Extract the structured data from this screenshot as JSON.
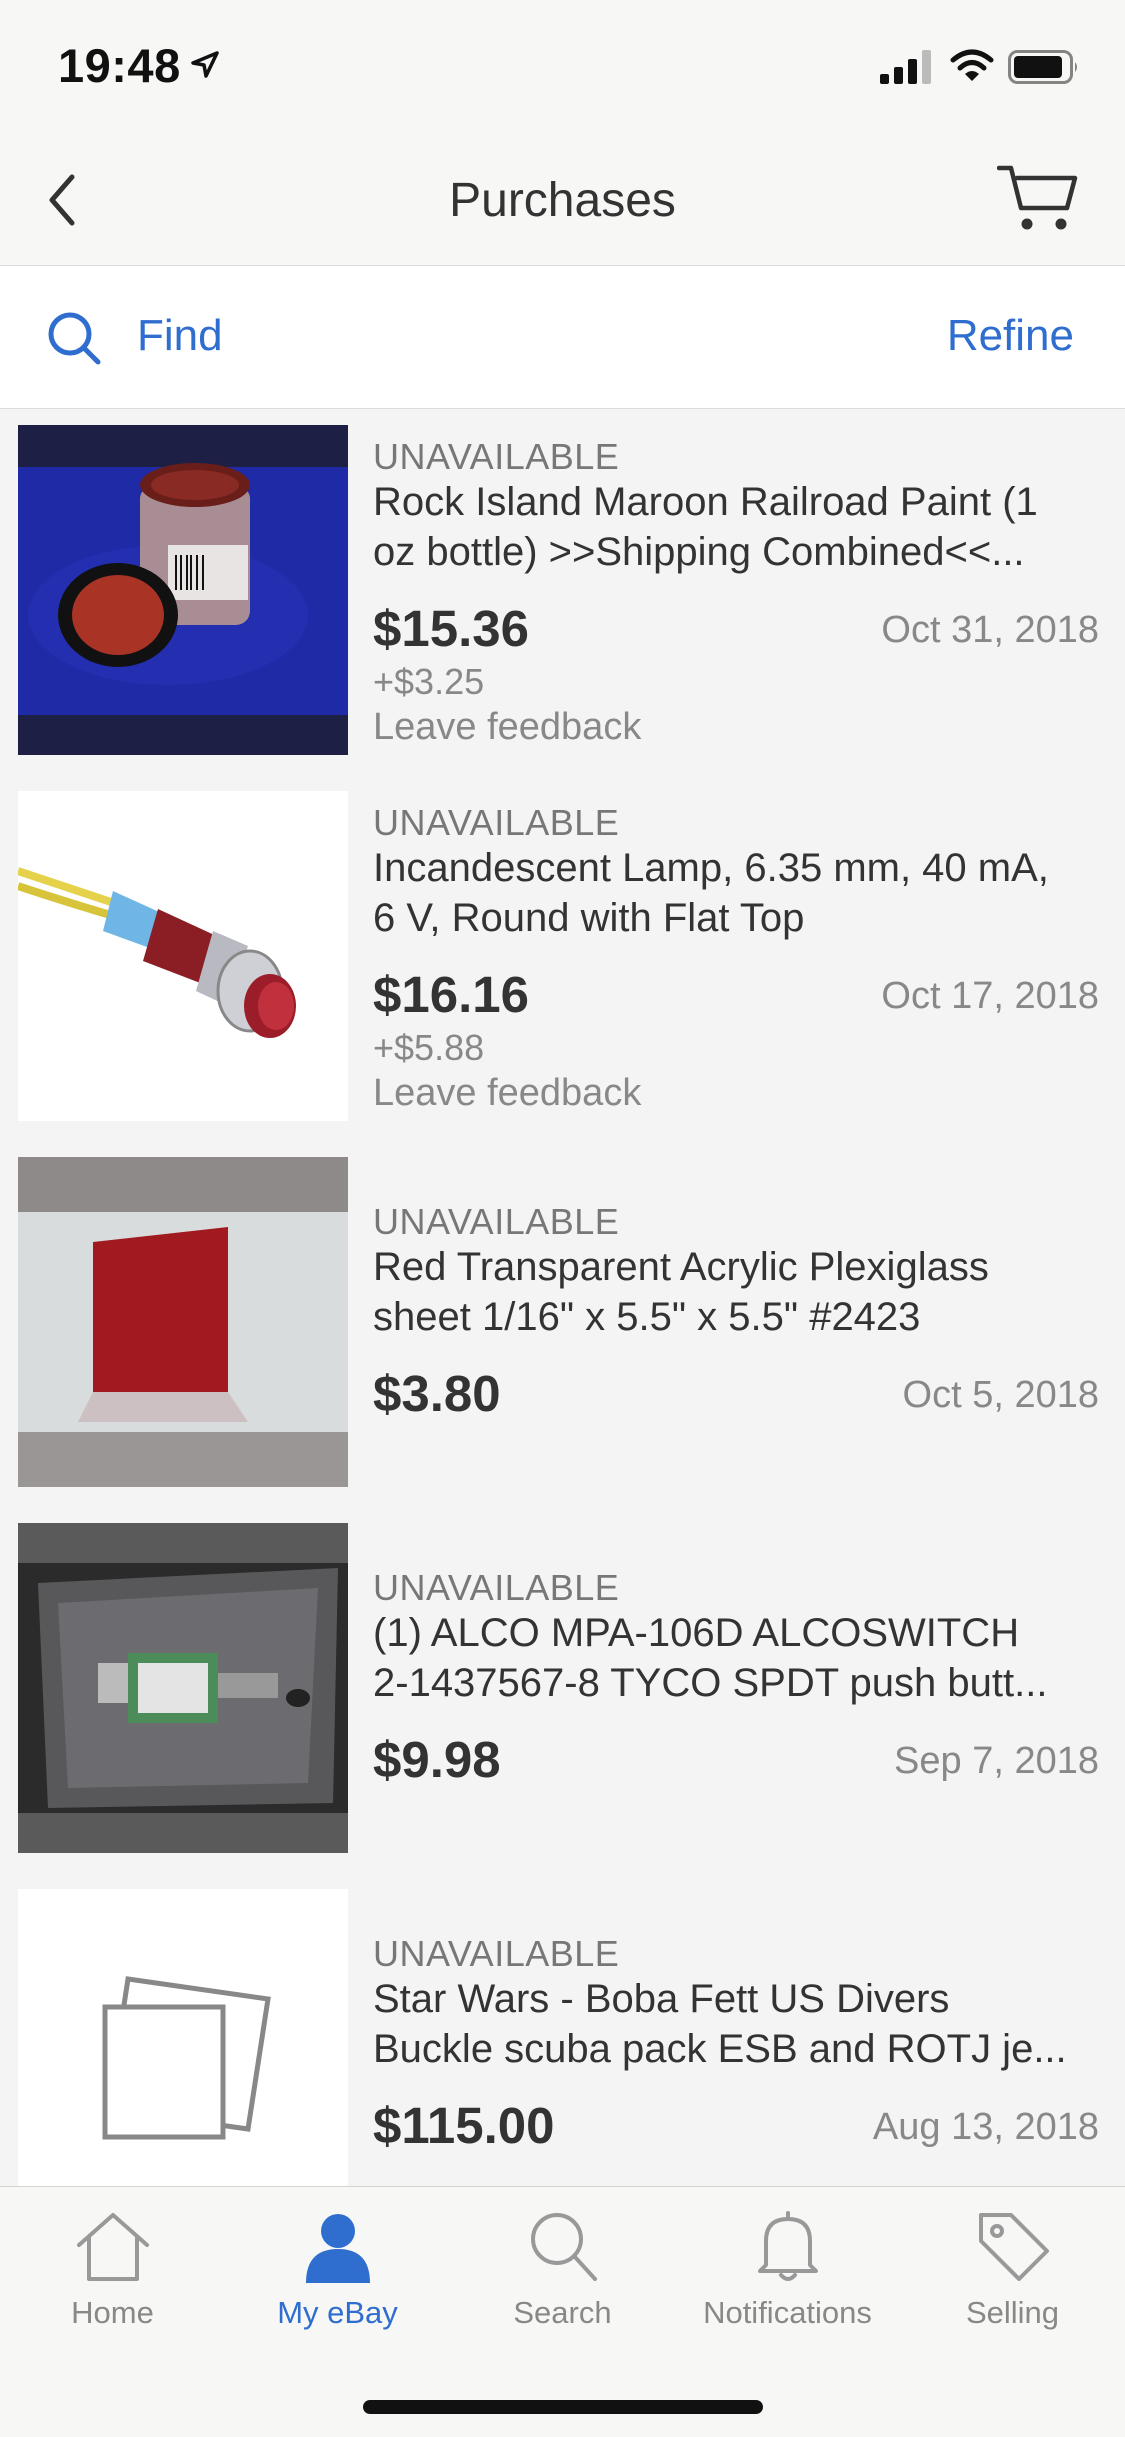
{
  "status_bar": {
    "time": "19:48"
  },
  "nav": {
    "title": "Purchases"
  },
  "find_bar": {
    "find_label": "Find",
    "refine_label": "Refine"
  },
  "items": [
    {
      "status": "UNAVAILABLE",
      "title_line1": "Rock Island Maroon Railroad Paint  (1",
      "title_line2": "oz bottle)  >>Shipping Combined<<...",
      "price": "$15.36",
      "date": "Oct 31, 2018",
      "shipping": "+$3.25",
      "feedback": "Leave feedback"
    },
    {
      "status": "UNAVAILABLE",
      "title_line1": "Incandescent Lamp, 6.35 mm, 40 mA,",
      "title_line2": "6 V, Round with Flat Top",
      "price": "$16.16",
      "date": "Oct 17, 2018",
      "shipping": "+$5.88",
      "feedback": "Leave feedback"
    },
    {
      "status": "UNAVAILABLE",
      "title_line1": "Red Transparent Acrylic Plexiglass",
      "title_line2": "sheet 1/16\" x 5.5\" x 5.5\" #2423",
      "price": "$3.80",
      "date": "Oct 5, 2018"
    },
    {
      "status": "UNAVAILABLE",
      "title_line1": "(1) ALCO MPA-106D ALCOSWITCH",
      "title_line2": "2-1437567-8 TYCO SPDT push butt...",
      "price": "$9.98",
      "date": "Sep 7, 2018"
    },
    {
      "status": "UNAVAILABLE",
      "title_line1": "Star Wars - Boba Fett US Divers",
      "title_line2": "Buckle scuba pack ESB and ROTJ je...",
      "price": "$115.00",
      "date": "Aug 13, 2018"
    }
  ],
  "tabs": [
    {
      "label": "Home",
      "icon": "home-icon"
    },
    {
      "label": "My eBay",
      "icon": "person-icon",
      "active": true
    },
    {
      "label": "Search",
      "icon": "search-icon"
    },
    {
      "label": "Notifications",
      "icon": "bell-icon"
    },
    {
      "label": "Selling",
      "icon": "tag-icon"
    }
  ],
  "colors": {
    "accent": "#2f6ecf",
    "background": "#f4f4f4",
    "text": "#333333",
    "muted": "#888888"
  }
}
